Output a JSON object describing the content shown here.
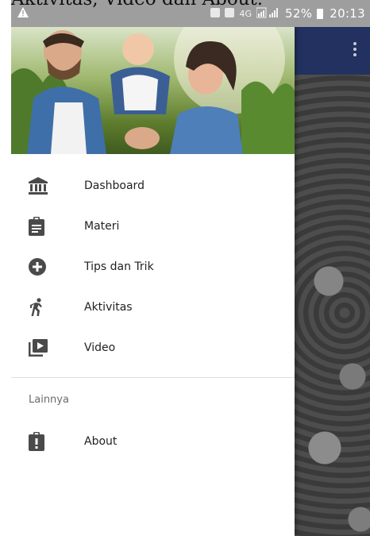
{
  "page": {
    "caption": "Aktivitas, Video dan About."
  },
  "status_bar": {
    "network": "4G",
    "battery": "52%",
    "time": "20:13"
  },
  "app_bar": {
    "overflow_icon": "more-vert-icon",
    "color": "#223160"
  },
  "drawer": {
    "header_image": "family-photo",
    "items": [
      {
        "label": "Dashboard",
        "icon": "bank-icon"
      },
      {
        "label": "Materi",
        "icon": "clipboard-icon"
      },
      {
        "label": "Tips dan Trik",
        "icon": "add-circle-icon"
      },
      {
        "label": "Aktivitas",
        "icon": "running-icon"
      },
      {
        "label": "Video",
        "icon": "video-library-icon"
      }
    ],
    "section_label": "Lainnya",
    "extra_items": [
      {
        "label": "About",
        "icon": "info-clipboard-icon"
      }
    ],
    "icon_color": "#4a4a4a"
  }
}
